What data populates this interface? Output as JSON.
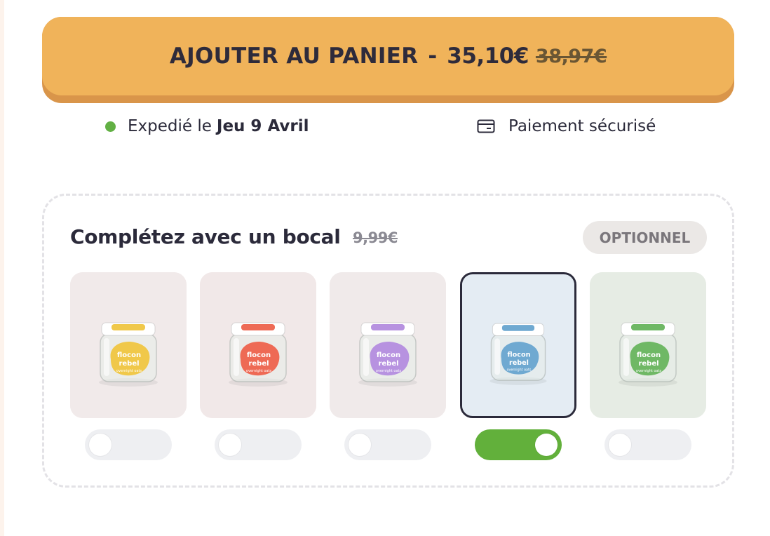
{
  "cta": {
    "label": "AJOUTER AU PANIER",
    "separator": "-",
    "price": "35,10€",
    "old_price": "38,97€",
    "color": "#f0b35a"
  },
  "shipping": {
    "prefix": "Expedié le",
    "date": "Jeu 9 Avril",
    "status_color": "#62b044"
  },
  "payment": {
    "label": "Paiement sécurisé",
    "icon": "credit-card-icon"
  },
  "upsell": {
    "title": "Complétez avec un bocal",
    "price": "9,99€",
    "badge": "OPTIONNEL",
    "products": [
      {
        "brand_line1": "flocon",
        "brand_line2": "rebel",
        "tagline": "overnight oats",
        "label_color": "#f0c84a",
        "bg": "#f1eaea",
        "selected": false,
        "enabled": false
      },
      {
        "brand_line1": "flocon",
        "brand_line2": "rebel",
        "tagline": "overnight oats",
        "label_color": "#ee6a55",
        "bg": "#f1e8e8",
        "selected": false,
        "enabled": false
      },
      {
        "brand_line1": "flocon",
        "brand_line2": "rebel",
        "tagline": "overnight oats",
        "label_color": "#b792e0",
        "bg": "#f0eaea",
        "selected": false,
        "enabled": false
      },
      {
        "brand_line1": "flocon",
        "brand_line2": "rebel",
        "tagline": "overnight oats",
        "label_color": "#6fa9d1",
        "bg": "#e4ecf3",
        "selected": true,
        "enabled": true
      },
      {
        "brand_line1": "flocon",
        "brand_line2": "rebel",
        "tagline": "overnight oats",
        "label_color": "#6fb865",
        "bg": "#e6ece4",
        "selected": false,
        "enabled": false
      }
    ],
    "toggle_on_color": "#62b03b"
  }
}
